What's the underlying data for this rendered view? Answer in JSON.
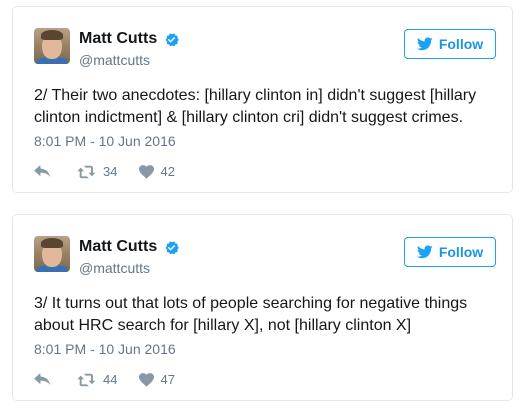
{
  "colors": {
    "accent": "#1da1f2",
    "text": "#14171a",
    "muted": "#657786",
    "border": "#e1e8ed"
  },
  "tweets": [
    {
      "author": {
        "name": "Matt Cutts",
        "handle": "@mattcutts"
      },
      "follow_label": "Follow",
      "text": "2/ Their two anecdotes: [hillary clinton in] didn't suggest [hillary clinton indictment] & [hillary clinton cri] didn't suggest crimes.",
      "timestamp": "8:01 PM - 10 Jun 2016",
      "retweets": "34",
      "likes": "42"
    },
    {
      "author": {
        "name": "Matt Cutts",
        "handle": "@mattcutts"
      },
      "follow_label": "Follow",
      "text": "3/ It turns out that lots of people searching for negative things about HRC search for [hillary X], not [hillary clinton X]",
      "timestamp": "8:01 PM - 10 Jun 2016",
      "retweets": "44",
      "likes": "47"
    }
  ],
  "icons": [
    "verified-icon",
    "twitter-bird-icon",
    "reply-icon",
    "retweet-icon",
    "heart-icon"
  ]
}
